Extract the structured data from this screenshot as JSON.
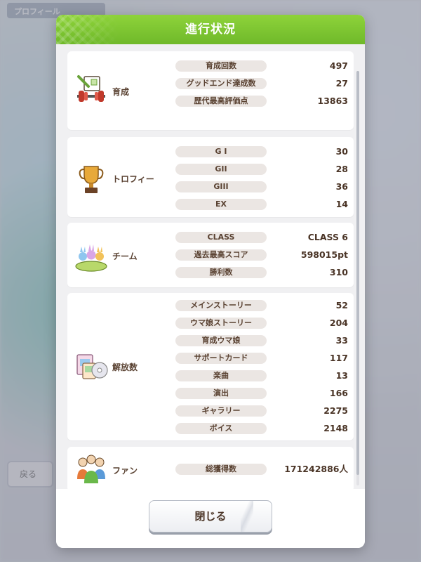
{
  "background": {
    "tab_label": "プロフィール",
    "back_label": "戻る"
  },
  "dialog": {
    "title": "進行状況",
    "close_label": "閉じる"
  },
  "sections": [
    {
      "label": "育成",
      "icon": "training-icon",
      "stats": [
        {
          "label": "育成回数",
          "value": "497"
        },
        {
          "label": "グッドエンド達成数",
          "value": "27"
        },
        {
          "label": "歴代最高評価点",
          "value": "13863"
        }
      ]
    },
    {
      "label": "トロフィー",
      "icon": "trophy-icon",
      "stats": [
        {
          "label": "G I",
          "value": "30"
        },
        {
          "label": "GII",
          "value": "28"
        },
        {
          "label": "GIII",
          "value": "36"
        },
        {
          "label": "EX",
          "value": "14"
        }
      ]
    },
    {
      "label": "チーム",
      "icon": "team-icon",
      "stats": [
        {
          "label": "CLASS",
          "value": "CLASS 6"
        },
        {
          "label": "過去最高スコア",
          "value": "598015pt"
        },
        {
          "label": "勝利数",
          "value": "310"
        }
      ]
    },
    {
      "label": "解放数",
      "icon": "unlock-icon",
      "stats": [
        {
          "label": "メインストーリー",
          "value": "52"
        },
        {
          "label": "ウマ娘ストーリー",
          "value": "204"
        },
        {
          "label": "育成ウマ娘",
          "value": "33"
        },
        {
          "label": "サポートカード",
          "value": "117"
        },
        {
          "label": "楽曲",
          "value": "13"
        },
        {
          "label": "演出",
          "value": "166"
        },
        {
          "label": "ギャラリー",
          "value": "2275"
        },
        {
          "label": "ボイス",
          "value": "2148"
        }
      ]
    },
    {
      "label": "ファン",
      "icon": "fans-icon",
      "stats": [
        {
          "label": "総獲得数",
          "value": "171242886人"
        }
      ]
    }
  ],
  "colors": {
    "header_green": "#7cc531",
    "pill_bg": "#ebe6e3",
    "text_brown": "#4a3426"
  }
}
